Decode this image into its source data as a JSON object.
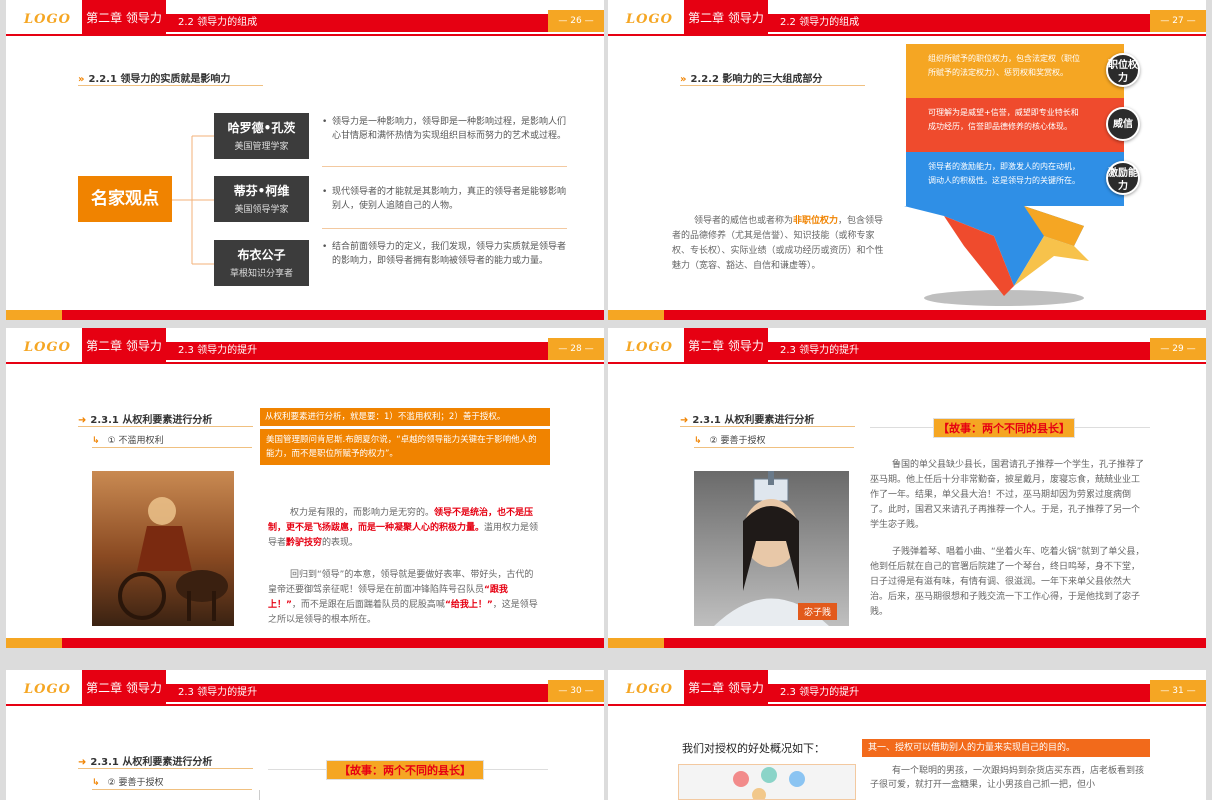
{
  "common": {
    "logo": "LOGO",
    "chapter": "第二章 领导力"
  },
  "slide1": {
    "section": "2.2 领导力的组成",
    "page": "— 26 —",
    "subtitle": "2.2.1 领导力的实质就是影响力",
    "center_label": "名家观点",
    "people": [
      {
        "name": "哈罗德•孔茨",
        "title": "美国管理学家"
      },
      {
        "name": "蒂芬•柯维",
        "title": "美国领导学家"
      },
      {
        "name": "布衣公子",
        "title": "草根知识分享者"
      }
    ],
    "bullets": [
      "领导力是一种影响力，领导即是一种影响过程，是影响人们心甘情愿和满怀热情为实现组织目标而努力的艺术或过程。",
      "现代领导者的才能就是其影响力，真正的领导者是能够影响别人，使别人追随自己的人物。",
      "结合前面领导力的定义，我们发现，领导力实质就是领导者的影响力，即领导者拥有影响被领导者的能力或力量。"
    ]
  },
  "slide2": {
    "section": "2.2 领导力的组成",
    "page": "— 27 —",
    "subtitle": "2.2.2 影响力的三大组成部分",
    "bands": [
      {
        "text": "组织所赋予的职位权力，包含法定权（职位所赋予的法定权力）、惩罚权和奖赏权。",
        "badge": "职位权力"
      },
      {
        "text": "可理解为是威望+信誉，威望即专业特长和成功经历，信誉即品德修养的核心体现。",
        "badge": "威信"
      },
      {
        "text": "领导者的激励能力，即激发人的内在动机，调动人的积极性。这是领导力的关键所在。",
        "badge": "激励能力"
      }
    ],
    "para_pre": "领导者的威信也或者称为",
    "para_hl": "非职位权力",
    "para_post": "，包含领导者的品德修养（尤其是信誉）、知识技能（或称专家权、专长权）、实际业绩（或成功经历或资历）和个性魅力（宽容、豁达、自信和谦虚等）。"
  },
  "slide3": {
    "section": "2.3 领导力的提升",
    "page": "— 28 —",
    "subtitle": "2.3.1 从权利要素进行分析",
    "sub2": "① 不滥用权利",
    "box1": "从权利要素进行分析，就是要：1）不滥用权利；2）善于授权。",
    "box2": "美国管理顾问肯尼斯.布朗夏尔说，“卓越的领导能力关键在于影响他人的能力，而不是职位所赋予的权力”。",
    "p1_a": "权力是有限的，而影响力是无穷的。",
    "p1_b": "领导不是统治，也不是压制，更不是飞扬跋扈，而是一种凝聚人心的积极力量。",
    "p1_c": "滥用权力是领导者",
    "p1_d": "黔驴技穷",
    "p1_e": "的表现。",
    "p2_a": "回归到“领导”的本意，领导就是要做好表率、带好头，古代的皇帝还要御驾亲征呢！领导是在前面冲锋陷阵号召队员",
    "p2_b": "“跟我上！”",
    "p2_c": "，而不是跟在后面踹着队员的屁股高喊",
    "p2_d": "“给我上！”",
    "p2_e": "，这是领导之所以是领导的根本所在。"
  },
  "slide4": {
    "section": "2.3 领导力的提升",
    "page": "— 29 —",
    "subtitle": "2.3.1 从权利要素进行分析",
    "sub2": "② 要善于授权",
    "story_tag": "【故事：两个不同的县长】",
    "caption": "宓子贱",
    "p1": "鲁国的单父县缺少县长，国君请孔子推荐一个学生，孔子推荐了巫马期。他上任后十分非常勤奋，披星戴月，废寝忘食，兢兢业业工作了一年。结果，单父县大治！不过，巫马期却因为劳累过度病倒了。此时，国君又来请孔子再推荐一个人。于是，孔子推荐了另一个学生宓子贱。",
    "p2": "子贱弹着琴、唱着小曲、“坐着火车、吃着火锅”就到了单父县，他到任后就在自己的官署后院建了一个琴台，终日鸣琴，身不下堂，日子过得是有滋有味，有情有调、很滋润。一年下来单父县依然大治。后来，巫马期很想和子贱交流一下工作心得，于是他找到了宓子贱。"
  },
  "slide5": {
    "section": "2.3 领导力的提升",
    "page": "— 30 —",
    "subtitle": "2.3.1 从权利要素进行分析",
    "sub2": "② 要善于授权",
    "story_tag": "【故事：两个不同的县长】"
  },
  "slide6": {
    "section": "2.3 领导力的提升",
    "page": "— 31 —",
    "heading": "我们对授权的好处概况如下：",
    "box": "其一、授权可以借助别人的力量来实现自己的目的。",
    "p": "有一个聪明的男孩，一次跟妈妈到杂货店买东西，店老板看到孩子很可爱，就打开一盒糖果，让小男孩自己抓一把，但小"
  }
}
